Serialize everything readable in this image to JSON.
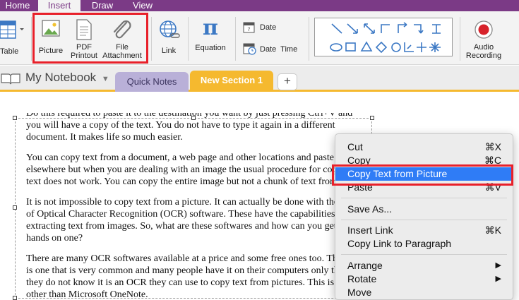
{
  "menu_tabs": [
    {
      "label": "Home",
      "active": false
    },
    {
      "label": "Insert",
      "active": true
    },
    {
      "label": "Draw",
      "active": false
    },
    {
      "label": "View",
      "active": false
    }
  ],
  "ribbon": {
    "table_label": "Table",
    "picture_label": "Picture",
    "pdf_label": "PDF Printout",
    "pdf_label_line1": "PDF",
    "pdf_label_line2": "Printout",
    "file_label_line1": "File",
    "file_label_line2": "Attachment",
    "link_label": "Link",
    "equation_label": "Equation",
    "date_label": "Date",
    "date_time_label": "Date  Time",
    "audio_label_line1": "Audio",
    "audio_label_line2": "Recording"
  },
  "notebook": {
    "name": "My Notebook",
    "sections": [
      {
        "label": "Quick Notes",
        "color": "#b9b0d8",
        "active": false
      },
      {
        "label": "New Section 1",
        "color": "#f5b92f",
        "active": true
      }
    ],
    "add_label": "+"
  },
  "document": {
    "paragraphs": [
      "Do this required to paste it to the destination you want by just pressing Ctrl+V and you will have a copy of the text. You do not have to type it again in a different document. It makes life so much easier.",
      "You can copy text from a document, a web page and other locations and paste it elsewhere but when you are dealing with an image the usual procedure for copying text does not work. You can copy the entire image but not a chunk of text from it.",
      "It is not impossible to copy text from a picture. It can actually be done with the use of Optical Character Recognition (OCR) software. These have the capabilities of extracting text from images. So, what are these softwares and how can you get your hands on one?",
      "There are many OCR softwares available at a price and some free ones too. There is one that is very common and many people have it on their computers only that they do not know it is an OCR they can use to copy text from pictures. This is none other than Microsoft OneNote."
    ]
  },
  "context_menu": {
    "items": [
      {
        "label": "Cut",
        "shortcut": "⌘X",
        "selected": false
      },
      {
        "label": "Copy",
        "shortcut": "⌘C",
        "selected": false
      },
      {
        "label": "Copy Text from Picture",
        "shortcut": "",
        "selected": true
      },
      {
        "label": "Paste",
        "shortcut": "⌘V",
        "selected": false
      },
      {
        "label": "Save As...",
        "shortcut": "",
        "selected": false
      },
      {
        "label": "Insert Link",
        "shortcut": "⌘K",
        "selected": false
      },
      {
        "label": "Copy Link to Paragraph",
        "shortcut": "",
        "selected": false
      },
      {
        "label": "Arrange",
        "shortcut": "▶",
        "selected": false
      },
      {
        "label": "Rotate",
        "shortcut": "▶",
        "selected": false
      },
      {
        "label": "Move",
        "shortcut": "",
        "selected": false
      }
    ]
  },
  "colors": {
    "brand": "#7b3a86",
    "highlight": "#e8202a",
    "selection": "#2f7cf6",
    "section_active": "#f5b92f"
  }
}
